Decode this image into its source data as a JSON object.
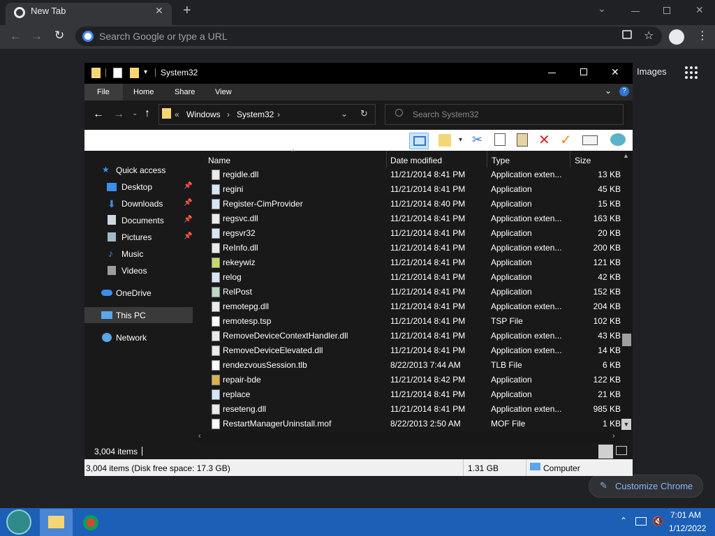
{
  "browser": {
    "tab_title": "New Tab",
    "tab_close": "✕",
    "new_tab": "+",
    "omnibox_placeholder": "Search Google or type a URL",
    "images_link": "Images",
    "customize_label": "Customize Chrome"
  },
  "explorer": {
    "title": "System32",
    "ribbon_tabs": [
      "File",
      "Home",
      "Share",
      "View"
    ],
    "breadcrumb": [
      "«",
      "Windows",
      "›",
      "System32",
      "›"
    ],
    "search_placeholder": "Search System32",
    "sidebar": [
      {
        "label": "Quick access",
        "icon": "star-icon",
        "color": "#3b8eea"
      },
      {
        "label": "Desktop",
        "icon": "desktop-icon",
        "color": "#3b8eea",
        "pinned": true
      },
      {
        "label": "Downloads",
        "icon": "download-icon",
        "color": "#3b8eea",
        "pinned": true
      },
      {
        "label": "Documents",
        "icon": "document-icon",
        "color": "#cfd8dc",
        "pinned": true
      },
      {
        "label": "Pictures",
        "icon": "pictures-icon",
        "color": "#cfd8dc",
        "pinned": true
      },
      {
        "label": "Music",
        "icon": "music-icon",
        "color": "#3b8eea"
      },
      {
        "label": "Videos",
        "icon": "videos-icon",
        "color": "#9e9e9e"
      },
      {
        "label": "OneDrive",
        "icon": "cloud-icon",
        "color": "#3b8eea"
      },
      {
        "label": "This PC",
        "icon": "computer-icon",
        "color": "#5aa7e8",
        "selected": true
      },
      {
        "label": "Network",
        "icon": "network-icon",
        "color": "#5aa7e8"
      }
    ],
    "columns": [
      "Name",
      "Date modified",
      "Type",
      "Size"
    ],
    "files": [
      {
        "name": "regidle.dll",
        "date": "11/21/2014 8:41 PM",
        "type": "Application exten...",
        "size": "13 KB"
      },
      {
        "name": "regini",
        "date": "11/21/2014 8:41 PM",
        "type": "Application",
        "size": "45 KB"
      },
      {
        "name": "Register-CimProvider",
        "date": "11/21/2014 8:40 PM",
        "type": "Application",
        "size": "15 KB"
      },
      {
        "name": "regsvc.dll",
        "date": "11/21/2014 8:41 PM",
        "type": "Application exten...",
        "size": "163 KB"
      },
      {
        "name": "regsvr32",
        "date": "11/21/2014 8:41 PM",
        "type": "Application",
        "size": "20 KB"
      },
      {
        "name": "ReInfo.dll",
        "date": "11/21/2014 8:41 PM",
        "type": "Application exten...",
        "size": "200 KB"
      },
      {
        "name": "rekeywiz",
        "date": "11/21/2014 8:41 PM",
        "type": "Application",
        "size": "121 KB"
      },
      {
        "name": "relog",
        "date": "11/21/2014 8:41 PM",
        "type": "Application",
        "size": "42 KB"
      },
      {
        "name": "RelPost",
        "date": "11/21/2014 8:41 PM",
        "type": "Application",
        "size": "152 KB"
      },
      {
        "name": "remotepg.dll",
        "date": "11/21/2014 8:41 PM",
        "type": "Application exten...",
        "size": "204 KB"
      },
      {
        "name": "remotesp.tsp",
        "date": "11/21/2014 8:41 PM",
        "type": "TSP File",
        "size": "102 KB"
      },
      {
        "name": "RemoveDeviceContextHandler.dll",
        "date": "11/21/2014 8:41 PM",
        "type": "Application exten...",
        "size": "43 KB"
      },
      {
        "name": "RemoveDeviceElevated.dll",
        "date": "11/21/2014 8:41 PM",
        "type": "Application exten...",
        "size": "14 KB"
      },
      {
        "name": "rendezvousSession.tlb",
        "date": "8/22/2013 7:44 AM",
        "type": "TLB File",
        "size": "6 KB"
      },
      {
        "name": "repair-bde",
        "date": "11/21/2014 8:42 PM",
        "type": "Application",
        "size": "122 KB"
      },
      {
        "name": "replace",
        "date": "11/21/2014 8:41 PM",
        "type": "Application",
        "size": "21 KB"
      },
      {
        "name": "reseteng.dll",
        "date": "11/21/2014 8:41 PM",
        "type": "Application exten...",
        "size": "985 KB"
      },
      {
        "name": "RestartManagerUninstall.mof",
        "date": "8/22/2013 2:50 AM",
        "type": "MOF File",
        "size": "1 KB"
      }
    ],
    "item_count": "3,004 items",
    "status_left": "3,004 items (Disk free space: 17.3 GB)",
    "status_mid": "1.31 GB",
    "status_right": "Computer"
  },
  "taskbar": {
    "time": "7:01 AM",
    "date": "1/12/2022"
  }
}
